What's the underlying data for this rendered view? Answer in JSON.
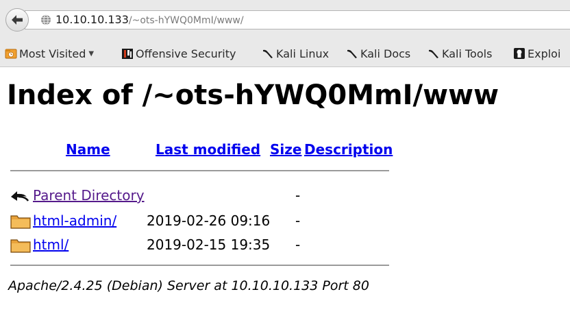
{
  "browser": {
    "url_host": "10.10.10.133",
    "url_path": "/~ots-hYWQ0MmI/www/"
  },
  "bookmarks": [
    {
      "label": "Most Visited",
      "icon": "most-visited-folder-icon",
      "has_caret": true
    },
    {
      "label": "Offensive Security",
      "icon": "offensive-security-icon"
    },
    {
      "label": "Kali Linux",
      "icon": "kali-dragon-icon"
    },
    {
      "label": "Kali Docs",
      "icon": "kali-dragon-icon"
    },
    {
      "label": "Kali Tools",
      "icon": "kali-dragon-icon"
    },
    {
      "label": "Exploi",
      "icon": "exploit-db-icon"
    }
  ],
  "page": {
    "title": "Index of /~ots-hYWQ0MmI/www",
    "columns": {
      "name": "Name",
      "last_modified": "Last modified",
      "size": "Size",
      "description": "Description"
    },
    "rows": [
      {
        "icon": "back-arrow-icon",
        "name": "Parent Directory",
        "modified": "",
        "size": "-",
        "visited": true
      },
      {
        "icon": "folder-icon",
        "name": "html-admin/",
        "modified": "2019-02-26 09:16",
        "size": "-",
        "visited": false
      },
      {
        "icon": "folder-icon",
        "name": "html/",
        "modified": "2019-02-15 19:35",
        "size": "-",
        "visited": false
      }
    ],
    "footer": "Apache/2.4.25 (Debian) Server at 10.10.10.133 Port 80"
  },
  "colors": {
    "link": "#0000ee",
    "visited_link": "#551a8b",
    "toolbar_bg": "#e9e9e9"
  }
}
